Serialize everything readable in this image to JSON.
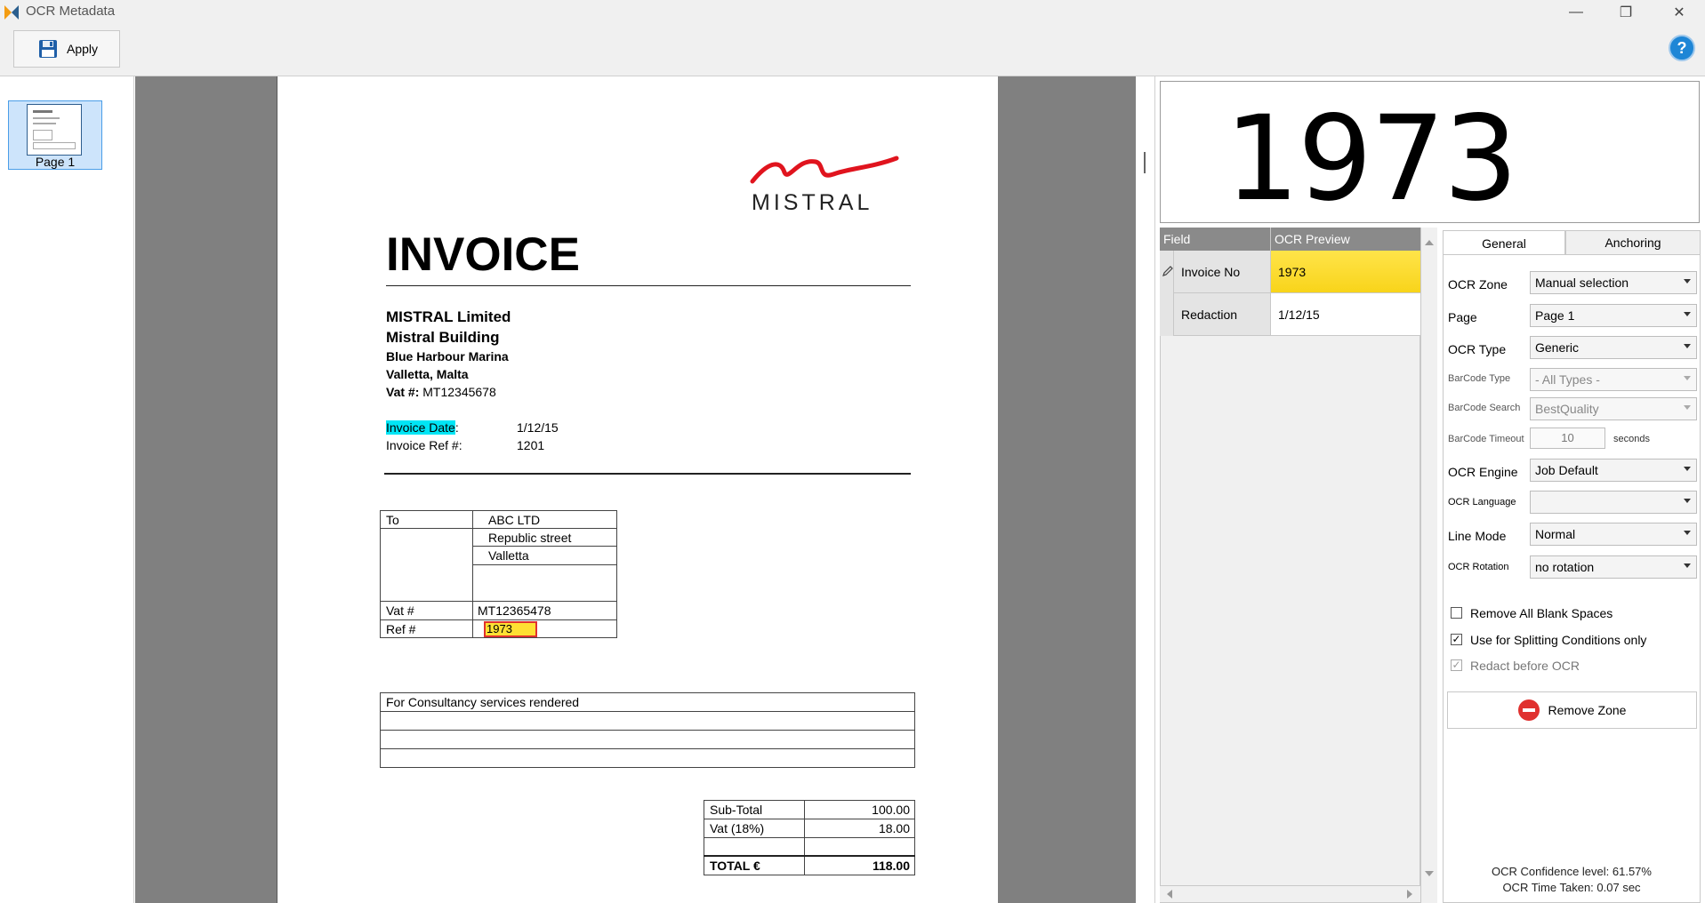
{
  "window": {
    "title": "OCR Metadata",
    "minimize_glyph": "—",
    "restore_glyph": "❐",
    "close_glyph": "✕"
  },
  "toolbar": {
    "apply_label": "Apply",
    "help_label": "?"
  },
  "thumbnails": [
    {
      "label": "Page 1"
    }
  ],
  "document": {
    "logo_text": "MISTRAL",
    "heading": "INVOICE",
    "company": {
      "name": "MISTRAL Limited",
      "building": "Mistral Building",
      "address1": "Blue Harbour Marina",
      "address2": "Valletta, Malta",
      "vat_label": "Vat #:",
      "vat_value": "MT12345678"
    },
    "invoice_date_label": "Invoice Date",
    "invoice_date_colon": ":",
    "invoice_date_value": "1/12/15",
    "invoice_ref_label": "Invoice Ref #:",
    "invoice_ref_value": "1201",
    "to_table": {
      "to_label": "To",
      "to_lines": [
        "ABC LTD",
        "Republic street",
        "Valletta"
      ],
      "vat_label": "Vat #",
      "vat_value": "MT12365478",
      "ref_label": "Ref #",
      "ref_value": "1973"
    },
    "services_line": "For Consultancy services rendered",
    "totals": {
      "subtotal_label": "Sub-Total",
      "subtotal_value": "100.00",
      "vat_label": "Vat (18%)",
      "vat_value": "18.00",
      "total_label": "TOTAL €",
      "total_value": "118.00"
    }
  },
  "ocr_preview": {
    "text": "1973"
  },
  "grid": {
    "headers": [
      "Field",
      "OCR Preview"
    ],
    "rows": [
      {
        "field": "Invoice No",
        "preview": "1973"
      },
      {
        "field": "Redaction",
        "preview": "1/12/15"
      }
    ]
  },
  "tabs": [
    {
      "label": "General"
    },
    {
      "label": "Anchoring"
    }
  ],
  "properties": {
    "ocr_zone_label": "OCR Zone",
    "ocr_zone_value": "Manual selection",
    "page_label": "Page",
    "page_value": "Page 1",
    "ocr_type_label": "OCR Type",
    "ocr_type_value": "Generic",
    "barcode_type_label": "BarCode Type",
    "barcode_type_value": "- All Types -",
    "barcode_search_label": "BarCode Search",
    "barcode_search_value": "BestQuality",
    "barcode_timeout_label": "BarCode Timeout",
    "barcode_timeout_value": "10",
    "barcode_timeout_unit": "seconds",
    "ocr_engine_label": "OCR Engine",
    "ocr_engine_value": "Job Default",
    "ocr_language_label": "OCR Language",
    "ocr_language_value": "",
    "line_mode_label": "Line Mode",
    "line_mode_value": "Normal",
    "ocr_rotation_label": "OCR Rotation",
    "ocr_rotation_value": "no rotation"
  },
  "options": [
    {
      "label": "Remove All Blank Spaces",
      "checked": false
    },
    {
      "label": "Use for Splitting Conditions only",
      "checked": true
    },
    {
      "label": "Redact before OCR",
      "checked": true,
      "disabled": true
    }
  ],
  "remove_zone_label": "Remove Zone",
  "stats": {
    "confidence": "OCR Confidence level: 61.57%",
    "time_taken": "OCR Time Taken: 0.07 sec"
  },
  "colors": {
    "highlight_yellow": "#ffe033",
    "highlight_cyan": "#00e5f5",
    "selection_red": "#e0312f",
    "accent_blue": "#1e86d6"
  }
}
